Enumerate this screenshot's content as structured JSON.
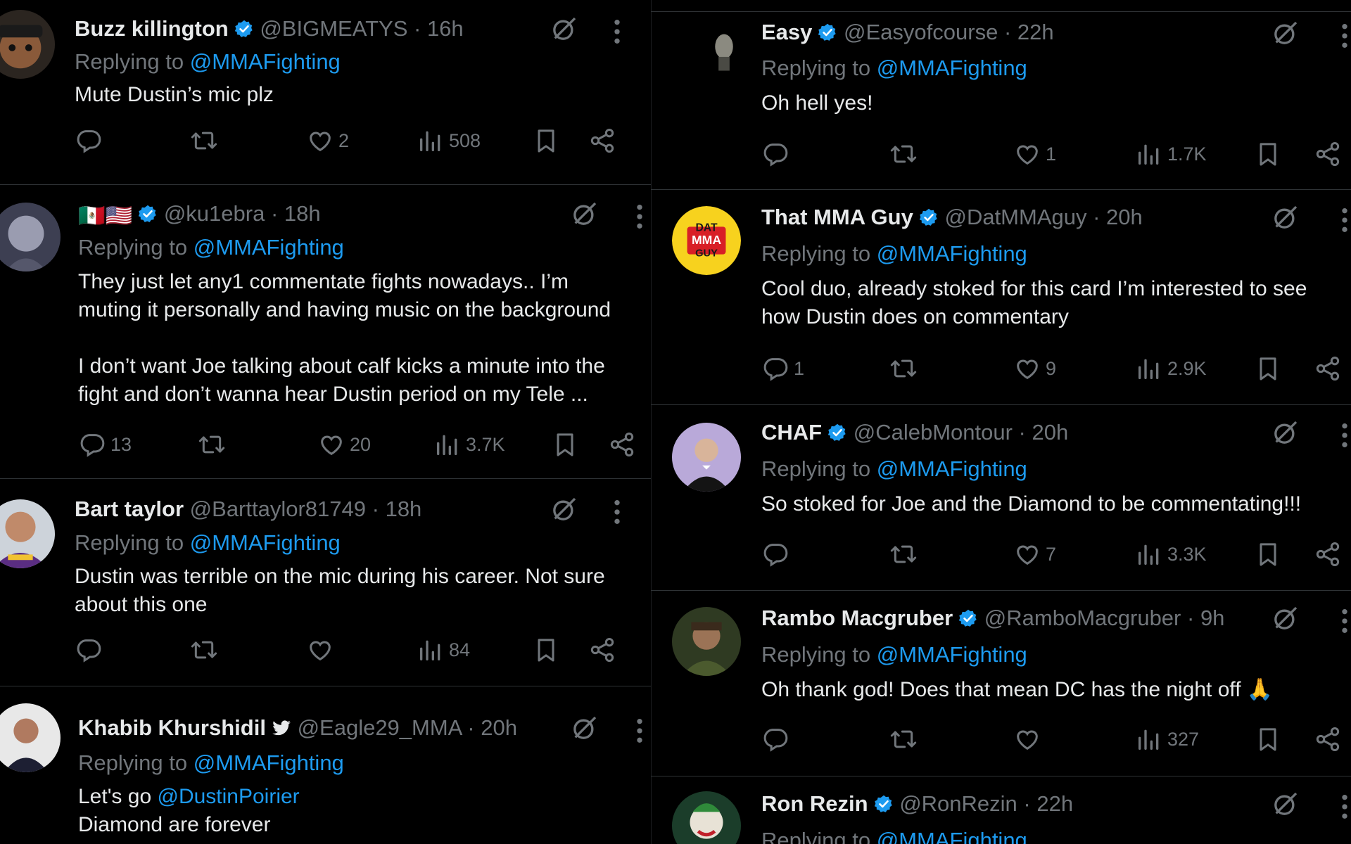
{
  "colors": {
    "background": "#000000",
    "text": "#e7e9ea",
    "muted": "#71767b",
    "link": "#1d9bf0",
    "verified": "#1d9bf0",
    "divider": "#2f3336"
  },
  "icons": {
    "reply": "reply-icon",
    "retweet": "retweet-icon",
    "like": "heart-icon",
    "views": "views-icon",
    "bookmark": "bookmark-icon",
    "share": "share-icon",
    "grok": "grok-icon",
    "more": "more-icon",
    "verified": "verified-badge-icon"
  },
  "left": [
    {
      "name": "Buzz killington",
      "badge": "verified",
      "handle": "@BIGMEATYS",
      "time": "16h",
      "replying_prefix": "Replying to ",
      "replying_to": "@MMAFighting",
      "text": "Mute Dustin’s mic plz",
      "replies": "",
      "likes": "2",
      "views": "508"
    },
    {
      "name": "",
      "flags": "🇲🇽🇺🇸",
      "badge": "verified",
      "handle": "@ku1ebra",
      "time": "18h",
      "replying_prefix": "Replying to ",
      "replying_to": "@MMAFighting",
      "text": "They just let any1 commentate fights nowadays.. I’m\nmuting it personally and having music on the background\n\nI don’t want Joe talking about calf kicks a minute into the\nfight and don’t wanna hear Dustin period on my Tele ...",
      "replies": "13",
      "likes": "20",
      "views": "3.7K"
    },
    {
      "name": "Bart taylor",
      "badge": "",
      "handle": "@Barttaylor81749",
      "time": "18h",
      "replying_prefix": "Replying to ",
      "replying_to": "@MMAFighting",
      "text": "Dustin was terrible on the mic during his career. Not sure\nabout this one",
      "replies": "",
      "likes": "",
      "views": "84"
    },
    {
      "name": "Khabib Khurshidil",
      "badge": "bird",
      "handle": "@Eagle29_MMA",
      "time": "20h",
      "replying_prefix": "Replying to ",
      "replying_to": "@MMAFighting",
      "text_prefix": "Let's go ",
      "text_mention": "@DustinPoirier",
      "text_line2": "Diamond are forever"
    }
  ],
  "right": [
    {
      "name": "Easy",
      "badge": "verified",
      "handle": "@Easyofcourse",
      "time": "22h",
      "replying_prefix": "Replying to ",
      "replying_to": "@MMAFighting",
      "text": "Oh hell yes!",
      "replies": "",
      "likes": "1",
      "views": "1.7K"
    },
    {
      "name": "That MMA Guy",
      "badge": "verified",
      "handle": "@DatMMAguy",
      "time": "20h",
      "avatar_text": [
        "DAT",
        "MMA",
        "GUY"
      ],
      "replying_prefix": "Replying to ",
      "replying_to": "@MMAFighting",
      "text": "Cool duo, already stoked for this card I’m interested to see\nhow Dustin does on commentary",
      "replies": "1",
      "likes": "9",
      "views": "2.9K"
    },
    {
      "name": "CHAF",
      "badge": "verified",
      "handle": "@CalebMontour",
      "time": "20h",
      "replying_prefix": "Replying to ",
      "replying_to": "@MMAFighting",
      "text": "So stoked for Joe and the Diamond to be commentating!!!",
      "replies": "",
      "likes": "7",
      "views": "3.3K"
    },
    {
      "name": "Rambo Macgruber",
      "badge": "verified",
      "handle": "@RamboMacgruber",
      "time": "9h",
      "replying_prefix": "Replying to ",
      "replying_to": "@MMAFighting",
      "text": "Oh thank god! Does that mean DC has the night off 🙏",
      "replies": "",
      "likes": "",
      "views": "327"
    },
    {
      "name": "Ron Rezin",
      "badge": "verified",
      "handle": "@RonRezin",
      "time": "22h",
      "replying_prefix": "Replying to ",
      "replying_to": "@MMAFighting"
    }
  ]
}
